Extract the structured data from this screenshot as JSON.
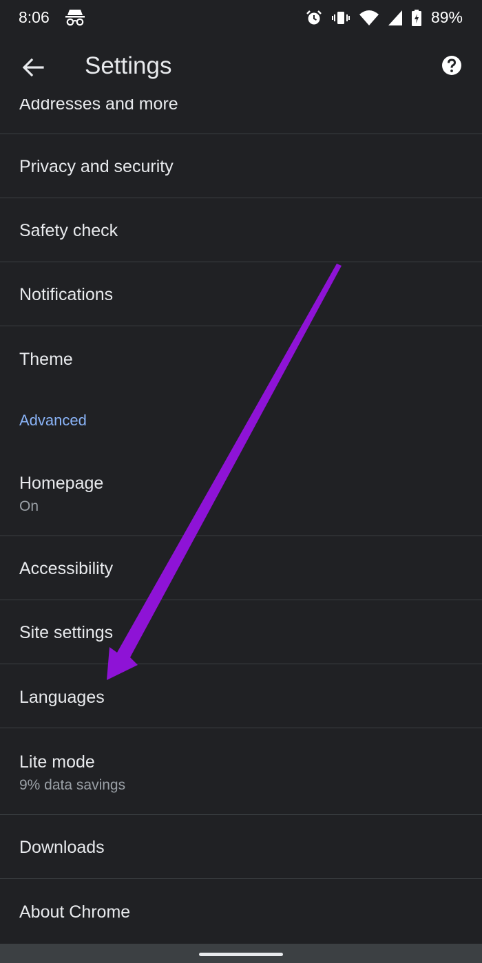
{
  "status_bar": {
    "time": "8:06",
    "battery": "89%",
    "icons": [
      "incognito-icon",
      "alarm-icon",
      "vibrate-icon",
      "wifi-icon",
      "signal-icon",
      "battery-icon"
    ]
  },
  "toolbar": {
    "title": "Settings",
    "back_icon": "arrow-back-icon",
    "help_icon": "help-icon"
  },
  "items": [
    {
      "label": "Addresses and more"
    },
    {
      "label": "Privacy and security"
    },
    {
      "label": "Safety check"
    },
    {
      "label": "Notifications"
    },
    {
      "label": "Theme"
    },
    {
      "label": "Homepage",
      "sub": "On"
    },
    {
      "label": "Accessibility"
    },
    {
      "label": "Site settings"
    },
    {
      "label": "Languages"
    },
    {
      "label": "Lite mode",
      "sub": "9% data savings"
    },
    {
      "label": "Downloads"
    },
    {
      "label": "About Chrome"
    }
  ],
  "sections": {
    "advanced": "Advanced"
  },
  "colors": {
    "background": "#202124",
    "accent": "#8ab4f8",
    "annotation_arrow": "#8e13d6"
  }
}
